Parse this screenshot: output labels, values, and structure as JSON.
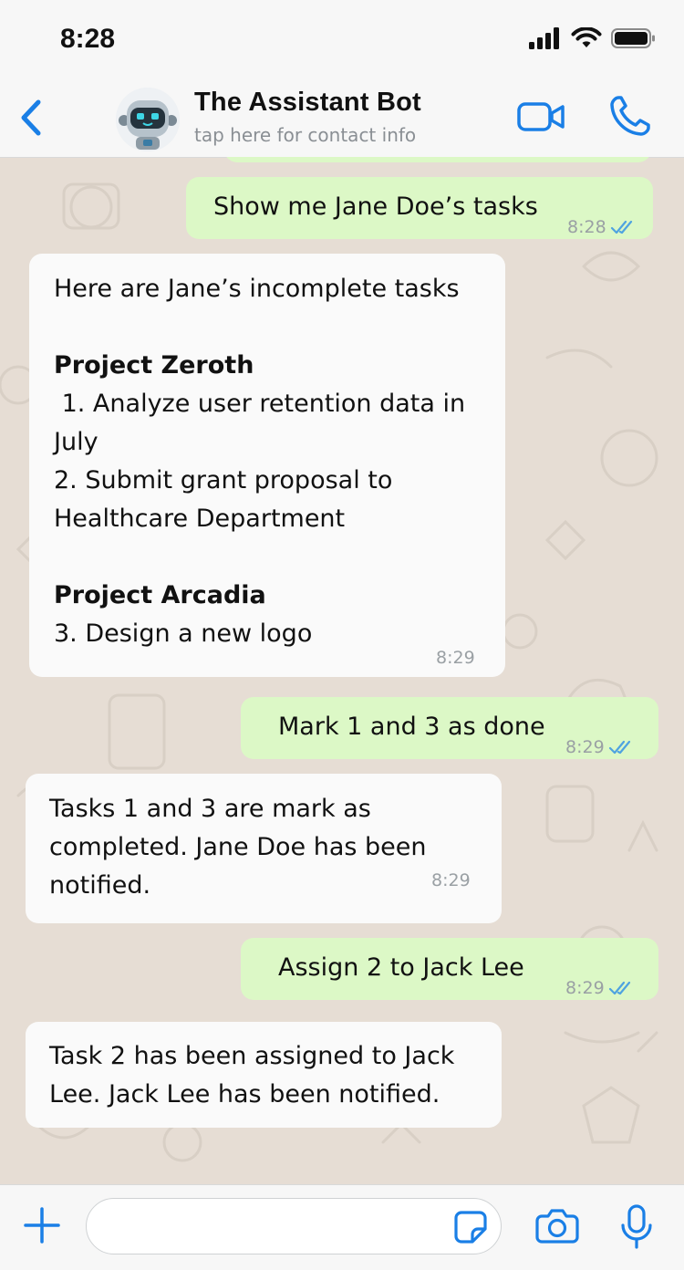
{
  "status_bar": {
    "time": "8:28"
  },
  "header": {
    "contact_name": "The Assistant Bot",
    "contact_subtitle": "tap here for contact info"
  },
  "messages": [
    {
      "direction": "outgoing",
      "text": "Show me Jane Doe’s tasks",
      "time": "8:28",
      "read": true
    },
    {
      "direction": "incoming",
      "lines": [
        {
          "text": "Here are Jane’s incomplete tasks",
          "bold": false
        },
        {
          "text": "",
          "bold": false
        },
        {
          "text": "Project Zeroth",
          "bold": true
        },
        {
          "text": " 1. Analyze user retention data in",
          "bold": false
        },
        {
          "text": "July",
          "bold": false
        },
        {
          "text": "2. Submit grant proposal to",
          "bold": false
        },
        {
          "text": "Healthcare Department",
          "bold": false
        },
        {
          "text": "",
          "bold": false
        },
        {
          "text": "Project Arcadia",
          "bold": true
        },
        {
          "text": "3. Design a new logo",
          "bold": false
        }
      ],
      "time": "8:29"
    },
    {
      "direction": "outgoing",
      "text": "Mark 1 and 3 as done",
      "time": "8:29",
      "read": true
    },
    {
      "direction": "incoming",
      "lines": [
        {
          "text": "Tasks 1 and 3 are mark as",
          "bold": false
        },
        {
          "text": "completed. Jane Doe has been",
          "bold": false
        },
        {
          "text": "notified.",
          "bold": false
        }
      ],
      "time": "8:29"
    },
    {
      "direction": "outgoing",
      "text": "Assign 2 to Jack Lee",
      "time": "8:29",
      "read": true
    },
    {
      "direction": "incoming",
      "lines": [
        {
          "text": "Task 2 has been assigned to Jack",
          "bold": false
        },
        {
          "text": "Lee. Jack Lee has been notified.",
          "bold": false
        }
      ]
    }
  ],
  "input": {
    "value": "",
    "placeholder": ""
  },
  "colors": {
    "accent": "#1a7fe6",
    "outgoing_bubble": "#dcf8c6",
    "incoming_bubble": "#fafafa",
    "chat_background": "#e6ddd4",
    "read_ticks": "#4fa3e0"
  },
  "icons": {
    "back": "chevron-left-icon",
    "video": "video-camera-icon",
    "call": "phone-icon",
    "plus": "plus-icon",
    "sticker": "sticker-icon",
    "camera": "camera-icon",
    "mic": "microphone-icon"
  }
}
